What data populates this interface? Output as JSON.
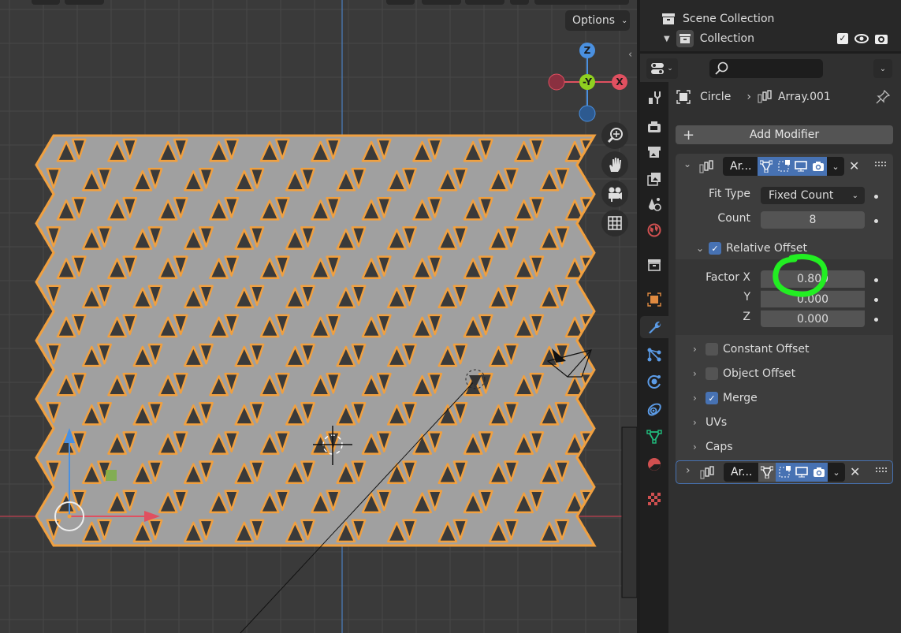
{
  "viewport": {
    "options_label": "Options",
    "gizmo": {
      "z": "Z",
      "y": "-Y",
      "x": "X"
    },
    "nav_icons": [
      "zoom-icon",
      "pan-hand-icon",
      "camera-view-icon",
      "ortho-grid-icon"
    ],
    "colors": {
      "grid_bg": "#3a3a3a",
      "mesh_fill": "#9a9a9a",
      "mesh_outline": "#f0a040",
      "axis_x": "#e05060",
      "axis_z": "#4a90e0",
      "annotation": "#22ee22"
    }
  },
  "outliner": {
    "scene_collection": "Scene Collection",
    "collection": "Collection"
  },
  "properties": {
    "search_placeholder": "",
    "breadcrumb": {
      "object": "Circle",
      "modifier": "Array.001"
    },
    "add_modifier": "Add Modifier",
    "modifier1": {
      "name": "Ar...",
      "fit_type_label": "Fit Type",
      "fit_type_value": "Fixed Count",
      "count_label": "Count",
      "count_value": "8",
      "relative_offset_label": "Relative Offset",
      "relative_offset_checked": true,
      "factor_x_label": "Factor X",
      "factor_x_value": "0.800",
      "y_label": "Y",
      "y_value": "0.000",
      "z_label": "Z",
      "z_value": "0.000",
      "constant_offset": "Constant Offset",
      "constant_offset_checked": false,
      "object_offset": "Object Offset",
      "object_offset_checked": false,
      "merge": "Merge",
      "merge_checked": true,
      "uvs": "UVs",
      "caps": "Caps"
    },
    "modifier2": {
      "name": "Ar..."
    },
    "tabs": [
      "tool",
      "render",
      "output",
      "view-layer",
      "scene",
      "world",
      "collection",
      "object",
      "modifiers",
      "particles",
      "physics",
      "constraints",
      "data",
      "material",
      "texture"
    ],
    "active_tab": "modifiers"
  }
}
